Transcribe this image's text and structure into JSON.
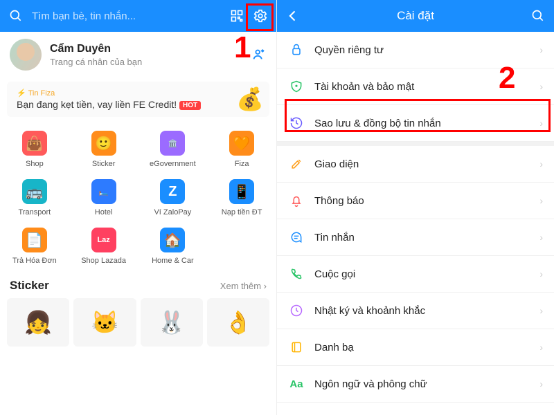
{
  "left": {
    "search_placeholder": "Tìm bạn bè, tin nhắn...",
    "profile": {
      "name": "Cẩm Duyên",
      "subtitle": "Trang cá nhân của bạn"
    },
    "banner": {
      "news_label": "Tin Fiza",
      "text": "Bạn đang kẹt tiền, vay liền FE Credit!",
      "hot": "HOT"
    },
    "utilities": [
      {
        "id": "shop",
        "label": "Shop",
        "icon": "👜",
        "bg": "#ff5a5a"
      },
      {
        "id": "sticker",
        "label": "Sticker",
        "icon": "🙂",
        "bg": "#ff8c1a"
      },
      {
        "id": "egov",
        "label": "eGovernment",
        "icon": "🏛️",
        "bg": "#9b6bff"
      },
      {
        "id": "fiza",
        "label": "Fiza",
        "icon": "🧡",
        "bg": "#ff8c1a"
      },
      {
        "id": "transport",
        "label": "Transport",
        "icon": "🚌",
        "bg": "#17b5c8"
      },
      {
        "id": "hotel",
        "label": "Hotel",
        "icon": "🛏️",
        "bg": "#2d7bff"
      },
      {
        "id": "zalopay",
        "label": "Ví ZaloPay",
        "icon": "Z",
        "bg": "#1a8eff"
      },
      {
        "id": "topup",
        "label": "Nạp tiền ĐT",
        "icon": "📱",
        "bg": "#1a8eff"
      },
      {
        "id": "bill",
        "label": "Trả Hóa Đơn",
        "icon": "📄",
        "bg": "#ff8c1a"
      },
      {
        "id": "lazada",
        "label": "Shop Lazada",
        "icon": "Laz",
        "bg": "#ff4060"
      },
      {
        "id": "homecar",
        "label": "Home & Car",
        "icon": "🏠",
        "bg": "#1a8eff"
      }
    ],
    "sticker_section": {
      "title": "Sticker",
      "more": "Xem thêm"
    }
  },
  "right": {
    "title": "Cài đặt",
    "items": [
      {
        "id": "privacy",
        "label": "Quyền riêng tư",
        "color": "#1a8eff",
        "svg": "lock"
      },
      {
        "id": "security",
        "label": "Tài khoản và bảo mật",
        "color": "#29c467",
        "svg": "shield"
      },
      {
        "id": "backup",
        "label": "Sao lưu & đồng bộ tin nhắn",
        "color": "#6a5cff",
        "svg": "history"
      },
      {
        "id": "theme",
        "label": "Giao diện",
        "color": "#ff9f1a",
        "svg": "brush"
      },
      {
        "id": "notif",
        "label": "Thông báo",
        "color": "#ff5a5a",
        "svg": "bell"
      },
      {
        "id": "message",
        "label": "Tin nhắn",
        "color": "#1a8eff",
        "svg": "chat"
      },
      {
        "id": "call",
        "label": "Cuộc gọi",
        "color": "#29c467",
        "svg": "phone"
      },
      {
        "id": "timeline",
        "label": "Nhật ký và khoảnh khắc",
        "color": "#b86aff",
        "svg": "clock"
      },
      {
        "id": "contacts",
        "label": "Danh bạ",
        "color": "#ffb400",
        "svg": "book"
      },
      {
        "id": "lang",
        "label": "Ngôn ngữ và phông chữ",
        "color": "#29c467",
        "svg": "aa"
      }
    ]
  },
  "annotations": {
    "num1": "1",
    "num2": "2"
  }
}
